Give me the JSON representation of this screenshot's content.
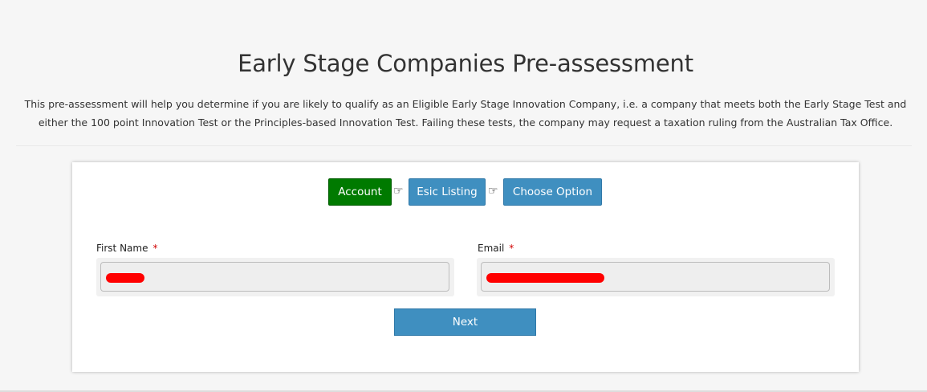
{
  "page": {
    "title": "Early Stage Companies Pre-assessment",
    "intro_line1": "This pre-assessment will help you determine if you are likely to qualify as an Eligible Early Stage Innovation Company, i.e. a company that meets both the Early Stage Test and",
    "intro_line2": "either the 100 point Innovation Test or the Principles-based Innovation Test. Failing these tests, the company may request a taxation ruling from the Australian Tax Office."
  },
  "steps": [
    {
      "label": "Account",
      "state": "active",
      "color": "#007a00"
    },
    {
      "label": "Esic Listing",
      "state": "inactive",
      "color": "#3f8fc0"
    },
    {
      "label": "Choose Option",
      "state": "inactive",
      "color": "#3f8fc0"
    }
  ],
  "step_separator_icon": "pointing-hand-right-icon",
  "step_separator_glyph": "☞",
  "form": {
    "first_name": {
      "label": "First Name",
      "required_mark": "*",
      "value": ""
    },
    "email": {
      "label": "Email",
      "required_mark": "*",
      "value": ""
    },
    "next_label": "Next"
  },
  "colors": {
    "accent": "#3f8fc0",
    "active_step": "#007a00",
    "required": "#d00000",
    "redaction": "#ff0000"
  }
}
